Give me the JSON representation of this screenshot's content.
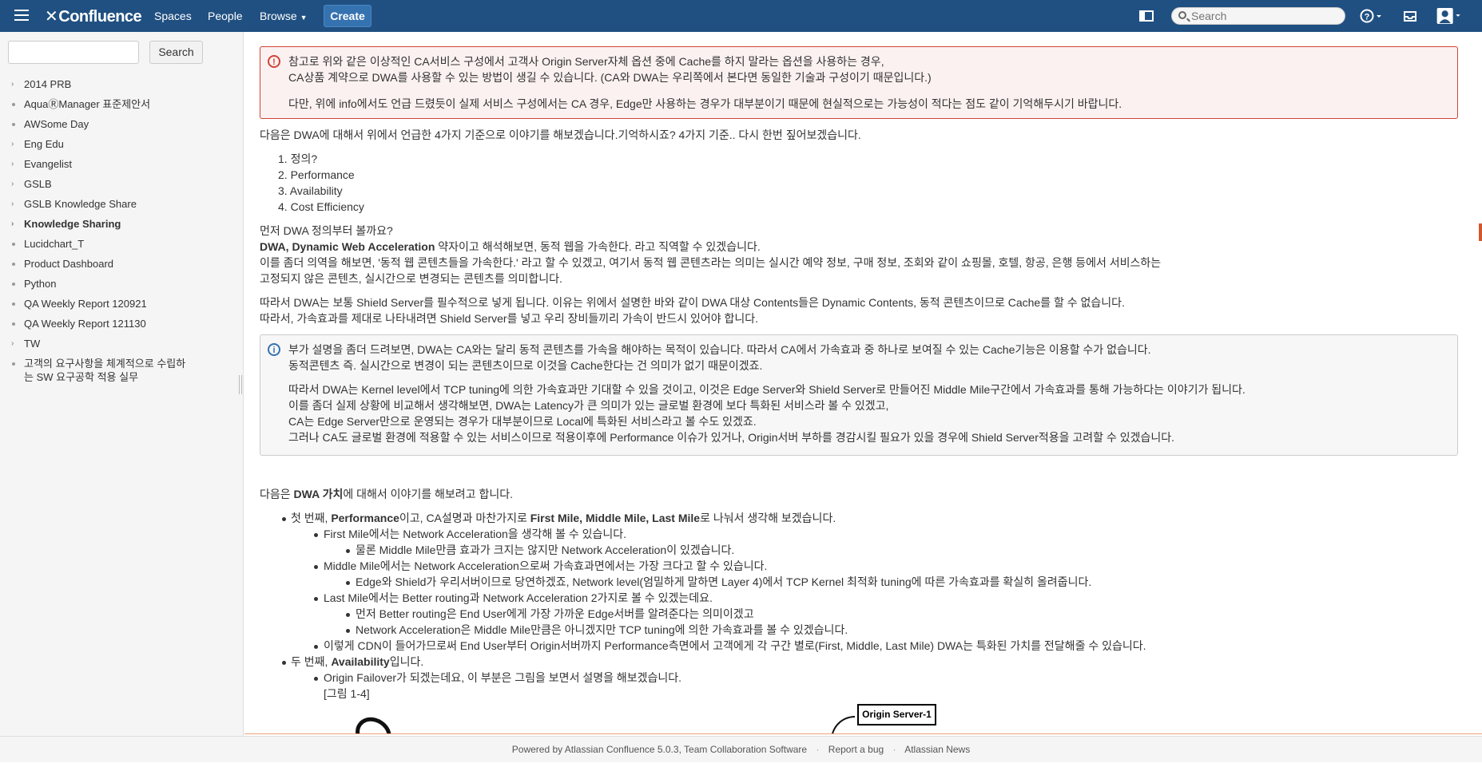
{
  "header": {
    "app_name": "Confluence",
    "nav": [
      "Spaces",
      "People",
      "Browse"
    ],
    "create_label": "Create",
    "search_placeholder": "Search"
  },
  "sidebar": {
    "search_button": "Search",
    "items": [
      {
        "label": "2014 PRB",
        "type": "expand"
      },
      {
        "label": "AquaⓇManager 표준제안서",
        "type": "dot"
      },
      {
        "label": "AWSome Day",
        "type": "dot"
      },
      {
        "label": "Eng Edu",
        "type": "expand"
      },
      {
        "label": "Evangelist",
        "type": "expand"
      },
      {
        "label": "GSLB",
        "type": "expand"
      },
      {
        "label": "GSLB Knowledge Share",
        "type": "expand"
      },
      {
        "label": "Knowledge Sharing",
        "type": "expand",
        "active": true
      },
      {
        "label": "Lucidchart_T",
        "type": "dot"
      },
      {
        "label": "Product Dashboard",
        "type": "dot"
      },
      {
        "label": "Python",
        "type": "dot"
      },
      {
        "label": "QA Weekly Report 120921",
        "type": "dot"
      },
      {
        "label": "QA Weekly Report 121130",
        "type": "dot"
      },
      {
        "label": "TW",
        "type": "expand"
      },
      {
        "label": "고객의 요구사항을 체계적으로 수립하는 SW 요구공학 적용 실무",
        "type": "dot"
      }
    ]
  },
  "content": {
    "err_panel": {
      "line1": "참고로 위와 같은 이상적인 CA서비스 구성에서 고객사 Origin Server자체 옵션 중에 Cache를 하지 말라는 옵션을 사용하는 경우,",
      "line2": "CA상품 계약으로 DWA를 사용할 수 있는 방법이 생길 수 있습니다. (CA와 DWA는 우리쪽에서 본다면 동일한 기술과 구성이기 때문입니다.)",
      "line3": "다만, 위에 info에서도 언급 드렸듯이 실제 서비스 구성에서는 CA 경우, Edge만 사용하는 경우가 대부분이기 때문에 현실적으로는 가능성이 적다는 점도 같이 기억해두시기 바랍니다."
    },
    "intro": "다음은 DWA에 대해서 위에서 언급한 4가지 기준으로 이야기를 해보겠습니다.기억하시죠? 4가지 기준.. 다시 한번 짚어보겠습니다.",
    "criteria": [
      "정의?",
      "Performance",
      "Availability",
      "Cost Efficiency"
    ],
    "def_q": "먼저 DWA 정의부터 볼까요?",
    "def_bold": "DWA, Dynamic Web Acceleration",
    "def_rest": " 약자이고 해석해보면, 동적 웹을 가속한다. 라고 직역할 수 있겠습니다.",
    "def_line2": "이를 좀더 의역을 해보면, '동적 웹 콘텐츠들을 가속한다.' 라고 할 수 있겠고, 여기서 동적 웹 콘텐츠라는 의미는 실시간 예약 정보, 구매 정보, 조회와 같이 쇼핑몰, 호텔, 항공, 은행 등에서 서비스하는",
    "def_line3": "고정되지 않은 콘텐츠, 실시간으로 변경되는 콘텐츠를 의미합니다.",
    "shield1": "따라서 DWA는 보통 Shield Server를 필수적으로 넣게 됩니다. 이유는 위에서 설명한 바와 같이 DWA 대상 Contents들은 Dynamic Contents, 동적 콘텐츠이므로 Cache를 할 수 없습니다.",
    "shield2": "따라서, 가속효과를 제대로 나타내려면 Shield Server를 넣고 우리 장비들끼리 가속이 반드시 있어야 합니다.",
    "info_panel": {
      "l1": "부가 설명을 좀더 드려보면, DWA는 CA와는 달리 동적 콘텐츠를 가속을 해야하는 목적이 있습니다. 따라서 CA에서 가속효과 중 하나로 보여질 수 있는 Cache기능은 이용할 수가 없습니다.",
      "l2": "동적콘텐츠 즉. 실시간으로 변경이 되는 콘텐츠이므로 이것을 Cache한다는 건 의미가 없기 때문이겠죠.",
      "l3": "따라서 DWA는 Kernel level에서 TCP tuning에 의한 가속효과만 기대할 수 있을 것이고, 이것은 Edge Server와 Shield Server로 만들어진 Middle Mile구간에서 가속효과를 통해 가능하다는 이야기가 됩니다.",
      "l4": "이를 좀더 실제 상황에 비교해서 생각해보면, DWA는 Latency가 큰 의미가 있는 글로벌 환경에 보다 특화된 서비스라 볼 수 있겠고,",
      "l5": "CA는 Edge Server만으로 운영되는 경우가 대부분이므로 Local에 특화된 서비스라고 볼 수도 있겠죠.",
      "l6": "그러나 CA도 글로벌 환경에 적용할 수 있는 서비스이므로 적용이후에 Performance 이슈가 있거나, Origin서버 부하를 경감시킬 필요가 있을 경우에 Shield Server적용을 고려할 수 있겠습니다."
    },
    "value_pre": "다음은 ",
    "value_bold": "DWA 가치",
    "value_post": "에 대해서 이야기를 해보려고 합니다.",
    "b1_pre": "첫 번째, ",
    "b1_bold1": "Performance",
    "b1_mid": "이고, CA설명과 마찬가지로 ",
    "b1_bold2": "First Mile, Middle Mile, Last Mile",
    "b1_post": "로 나눠서 생각해 보겠습니다.",
    "b1a": "First Mile에서는 Network Acceleration을 생각해 볼 수 있습니다.",
    "b1a1": "물론 Middle Mile만큼 효과가 크지는 않지만 Network Acceleration이 있겠습니다.",
    "b1b": "Middle Mile에서는 Network Acceleration으로써 가속효과면에서는 가장 크다고 할 수 있습니다.",
    "b1b1": "Edge와 Shield가 우리서버이므로 당연하겠죠, Network level(엄밀하게 말하면 Layer 4)에서 TCP Kernel 최적화 tuning에 따른 가속효과를 확실히 올려줍니다.",
    "b1c": "Last Mile에서는 Better routing과 Network Acceleration 2가지로 볼 수 있겠는데요.",
    "b1c1": "먼저 Better routing은 End User에게 가장 가까운 Edge서버를 알려준다는 의미이겠고",
    "b1c2": "Network Acceleration은 Middle Mile만큼은 아니겠지만 TCP tuning에 의한 가속효과를 볼 수 있겠습니다.",
    "b1d": "이렇게 CDN이 들어가므로써 End User부터 Origin서버까지 Performance측면에서 고객에게 각 구간 별로(First, Middle, Last Mile) DWA는 특화된 가치를 전달해줄 수 있습니다.",
    "b2_pre": "두 번째, ",
    "b2_bold": "Availability",
    "b2_post": "입니다.",
    "b2a": "Origin Failover가 되겠는데요, 이 부분은 그림을 보면서 설명을 해보겠습니다.",
    "fig_label": "[그림 1-4]",
    "diagram_label": "Origin Server-1"
  },
  "footer": {
    "powered": "Powered by Atlassian Confluence 5.0.3, Team Collaboration Software",
    "bug": "Report a bug",
    "news": "Atlassian News"
  }
}
